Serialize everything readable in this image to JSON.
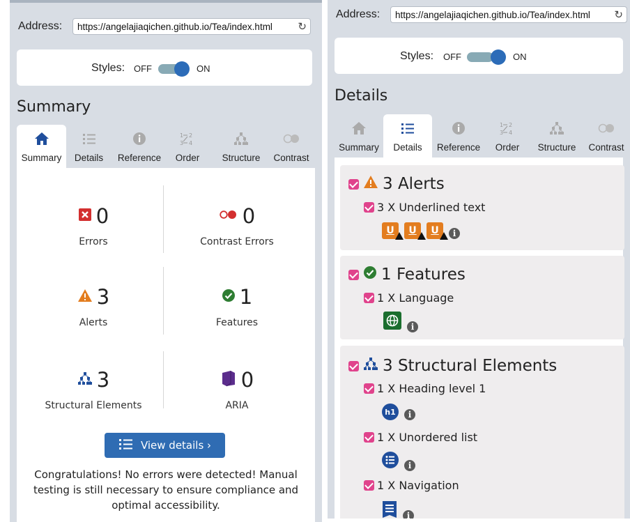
{
  "left": {
    "address_label": "Address:",
    "address_value": "https://angelajiaqichen.github.io/Tea/index.html",
    "styles_label": "Styles:",
    "styles_off": "OFF",
    "styles_on": "ON",
    "title": "Summary",
    "tabs": [
      {
        "label": "Summary",
        "icon": "home-icon"
      },
      {
        "label": "Details",
        "icon": "list-icon"
      },
      {
        "label": "Reference",
        "icon": "info-icon"
      },
      {
        "label": "Order",
        "icon": "order-icon"
      },
      {
        "label": "Structure",
        "icon": "structure-icon"
      },
      {
        "label": "Contrast",
        "icon": "contrast-icon"
      }
    ],
    "active_tab": "Summary",
    "stats": {
      "errors": {
        "count": "0",
        "label": "Errors"
      },
      "contrast_errors": {
        "count": "0",
        "label": "Contrast Errors"
      },
      "alerts": {
        "count": "3",
        "label": "Alerts"
      },
      "features": {
        "count": "1",
        "label": "Features"
      },
      "structural": {
        "count": "3",
        "label": "Structural Elements"
      },
      "aria": {
        "count": "0",
        "label": "ARIA"
      }
    },
    "view_details_label": "View details ›",
    "congrats": "Congratulations! No errors were detected! Manual testing is still necessary to ensure compliance and optimal accessibility."
  },
  "right": {
    "address_label": "Address:",
    "address_value": "https://angelajiaqichen.github.io/Tea/index.html",
    "styles_label": "Styles:",
    "styles_off": "OFF",
    "styles_on": "ON",
    "title": "Details",
    "tabs": [
      {
        "label": "Summary",
        "icon": "home-icon"
      },
      {
        "label": "Details",
        "icon": "list-icon"
      },
      {
        "label": "Reference",
        "icon": "info-icon"
      },
      {
        "label": "Order",
        "icon": "order-icon"
      },
      {
        "label": "Structure",
        "icon": "structure-icon"
      },
      {
        "label": "Contrast",
        "icon": "contrast-icon"
      }
    ],
    "active_tab": "Details",
    "sections": {
      "alerts": {
        "heading": "3 Alerts",
        "items": [
          {
            "label": "3 X Underlined text"
          }
        ]
      },
      "features": {
        "heading": "1 Features",
        "items": [
          {
            "label": "1 X Language"
          }
        ]
      },
      "structural": {
        "heading": "3 Structural Elements",
        "items": [
          {
            "label": "1 X Heading level 1"
          },
          {
            "label": "1 X Unordered list"
          },
          {
            "label": "1 X Navigation"
          }
        ]
      }
    },
    "icon_texts": {
      "underline": "U",
      "heading": "h1",
      "info": "i"
    }
  },
  "colors": {
    "panel_bg": "#d8dde4",
    "toggle_knob": "#2c6cb8",
    "button_bg": "#2f6cb3",
    "error_red": "#d32f2f",
    "alert_orange": "#e37d1f",
    "feature_green": "#2e7d32",
    "structure_blue": "#1f4e9c",
    "aria_purple": "#5b2d8c",
    "checkbox_pink": "#e0438c"
  }
}
